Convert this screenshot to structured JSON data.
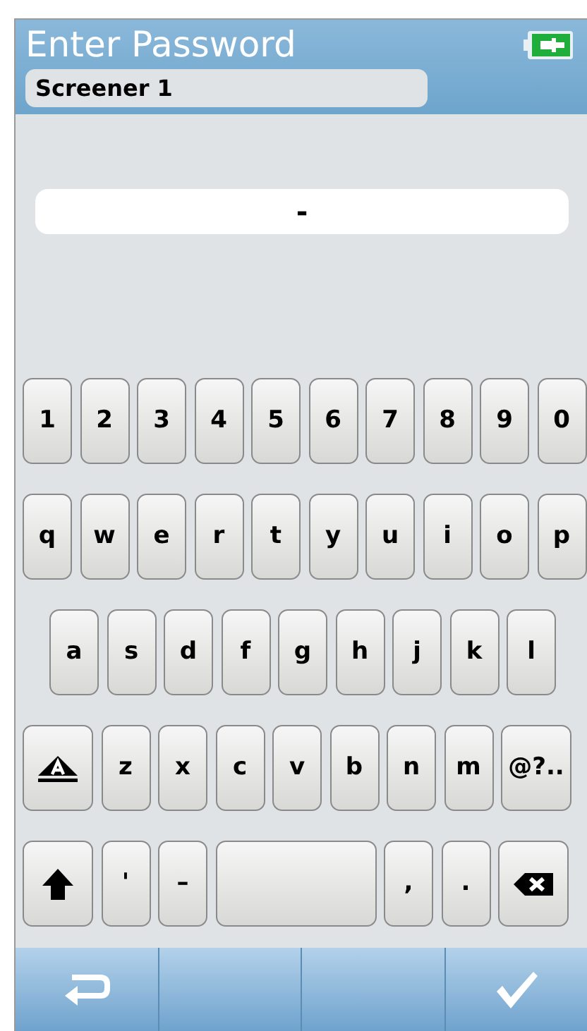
{
  "header": {
    "title": "Enter Password",
    "user": "Screener 1"
  },
  "password_field": {
    "value": "-"
  },
  "keyboard": {
    "rows": [
      [
        {
          "kind": "char",
          "label": "1"
        },
        {
          "kind": "char",
          "label": "2"
        },
        {
          "kind": "char",
          "label": "3"
        },
        {
          "kind": "char",
          "label": "4"
        },
        {
          "kind": "char",
          "label": "5"
        },
        {
          "kind": "char",
          "label": "6"
        },
        {
          "kind": "char",
          "label": "7"
        },
        {
          "kind": "char",
          "label": "8"
        },
        {
          "kind": "char",
          "label": "9"
        },
        {
          "kind": "char",
          "label": "0"
        }
      ],
      [
        {
          "kind": "char",
          "label": "q"
        },
        {
          "kind": "char",
          "label": "w"
        },
        {
          "kind": "char",
          "label": "e"
        },
        {
          "kind": "char",
          "label": "r"
        },
        {
          "kind": "char",
          "label": "t"
        },
        {
          "kind": "char",
          "label": "y"
        },
        {
          "kind": "char",
          "label": "u"
        },
        {
          "kind": "char",
          "label": "i"
        },
        {
          "kind": "char",
          "label": "o"
        },
        {
          "kind": "char",
          "label": "p"
        }
      ],
      [
        {
          "kind": "char",
          "label": "a"
        },
        {
          "kind": "char",
          "label": "s"
        },
        {
          "kind": "char",
          "label": "d"
        },
        {
          "kind": "char",
          "label": "f"
        },
        {
          "kind": "char",
          "label": "g"
        },
        {
          "kind": "char",
          "label": "h"
        },
        {
          "kind": "char",
          "label": "j"
        },
        {
          "kind": "char",
          "label": "k"
        },
        {
          "kind": "char",
          "label": "l"
        }
      ],
      [
        {
          "kind": "caps"
        },
        {
          "kind": "char",
          "label": "z"
        },
        {
          "kind": "char",
          "label": "x"
        },
        {
          "kind": "char",
          "label": "c"
        },
        {
          "kind": "char",
          "label": "v"
        },
        {
          "kind": "char",
          "label": "b"
        },
        {
          "kind": "char",
          "label": "n"
        },
        {
          "kind": "char",
          "label": "m"
        },
        {
          "kind": "symbols",
          "label": "@?.."
        }
      ],
      [
        {
          "kind": "shift"
        },
        {
          "kind": "char",
          "label": "'"
        },
        {
          "kind": "char",
          "label": "–"
        },
        {
          "kind": "space"
        },
        {
          "kind": "char",
          "label": ","
        },
        {
          "kind": "char",
          "label": "."
        },
        {
          "kind": "backspace"
        }
      ]
    ]
  },
  "toolbar": [
    {
      "kind": "back"
    },
    {
      "kind": "blank"
    },
    {
      "kind": "blank"
    },
    {
      "kind": "confirm"
    }
  ]
}
